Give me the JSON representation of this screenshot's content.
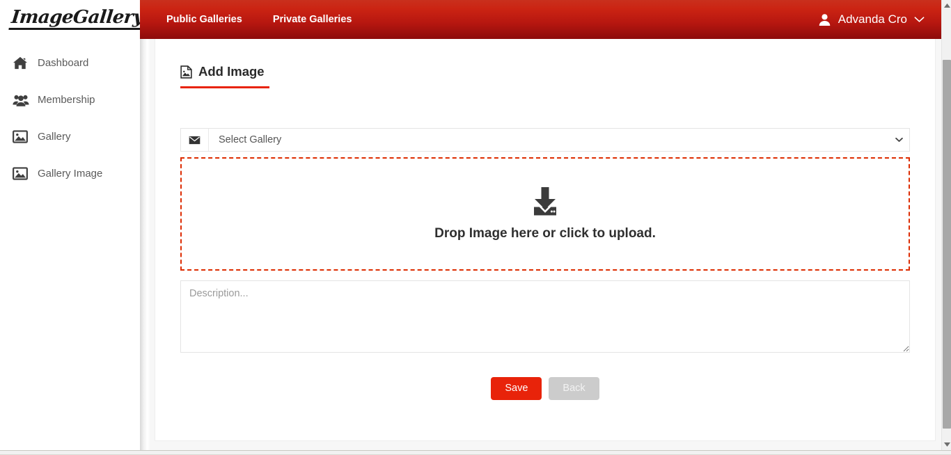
{
  "brand": {
    "name": "ImageGallery"
  },
  "header": {
    "nav": [
      {
        "label": "Public Galleries",
        "name": "nav-public-galleries"
      },
      {
        "label": "Private Galleries",
        "name": "nav-private-galleries"
      }
    ],
    "user": {
      "name": "Advanda Cro",
      "avatar_icon": "user-icon",
      "caret_icon": "chevron-down-icon"
    },
    "background_top": "#c9301d",
    "background_bottom": "#8d0b0b"
  },
  "sidebar": {
    "items": [
      {
        "label": "Dashboard",
        "icon": "home-icon"
      },
      {
        "label": "Membership",
        "icon": "users-icon"
      },
      {
        "label": "Gallery",
        "icon": "image-icon"
      },
      {
        "label": "Gallery Image",
        "icon": "image-icon"
      }
    ]
  },
  "main": {
    "page_title": "Add Image",
    "page_title_icon": "file-image-icon",
    "accent_color": "#e8230a",
    "gallery_select": {
      "addon_icon": "envelope-icon",
      "selected": "Select Gallery",
      "options": [
        "Select Gallery"
      ],
      "arrow_icon": "chevron-down-icon"
    },
    "dropzone": {
      "icon": "download-icon",
      "text": "Drop Image here or click to upload.",
      "border_color": "#dd2c00"
    },
    "description": {
      "placeholder": "Description...",
      "value": ""
    },
    "buttons": {
      "save": "Save",
      "back": "Back",
      "save_color": "#e8230a",
      "back_color": "#cccccc"
    }
  },
  "scrollbar": {
    "up_icon": "triangle-up-icon",
    "down_icon": "triangle-down-icon"
  }
}
